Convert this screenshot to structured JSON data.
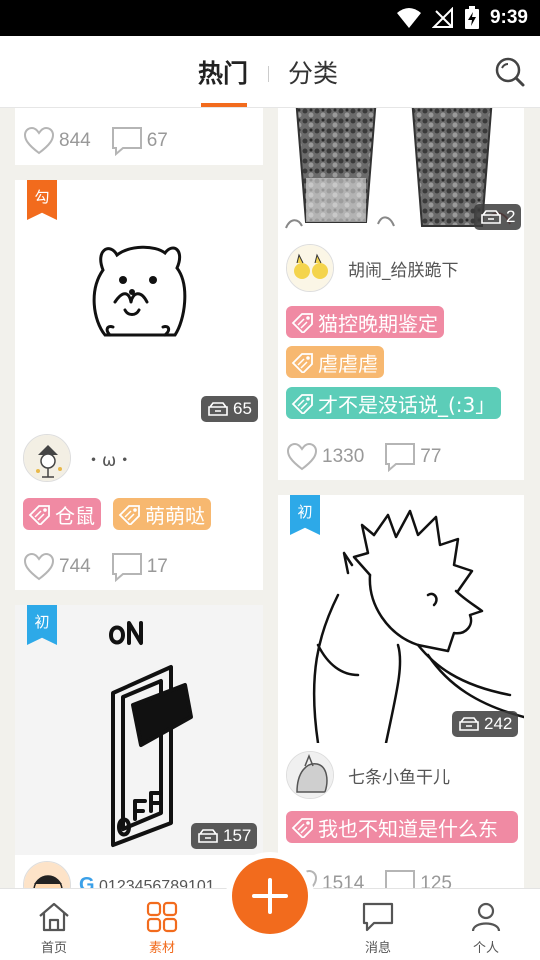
{
  "status_bar": {
    "time": "9:39"
  },
  "header": {
    "tabs": [
      {
        "label": "热门",
        "active": true
      },
      {
        "label": "分类",
        "active": false
      }
    ],
    "accent_color": "#f26b1d"
  },
  "feed": {
    "left_column": [
      {
        "likes": "844",
        "comments": "67"
      },
      {
        "corner_badge": "勾",
        "image_count": "65",
        "username": "・ω・",
        "tags": [
          "仓鼠",
          "萌萌哒"
        ],
        "likes": "744",
        "comments": "17"
      },
      {
        "corner_badge": "初",
        "image_count": "157",
        "username": "0123456789101"
      }
    ],
    "right_column": [
      {
        "image_count": "2",
        "username": "胡闹_给朕跪下",
        "tags": [
          "猫控晚期鉴定",
          "虐虐虐",
          "才不是没话说_(:3」"
        ],
        "likes": "1330",
        "comments": "77"
      },
      {
        "corner_badge": "初",
        "image_count": "242",
        "username": "七条小鱼干儿",
        "tags": [
          "我也不知道是什么东"
        ],
        "likes": "1514",
        "comments": "125"
      }
    ]
  },
  "bottom_nav": [
    {
      "label": "首页",
      "icon": "home-icon",
      "active": false
    },
    {
      "label": "素材",
      "icon": "grid-icon",
      "active": true
    },
    {
      "label": "消息",
      "icon": "message-icon",
      "active": false
    },
    {
      "label": "个人",
      "icon": "person-icon",
      "active": false
    }
  ],
  "fab_icon": "plus-icon"
}
